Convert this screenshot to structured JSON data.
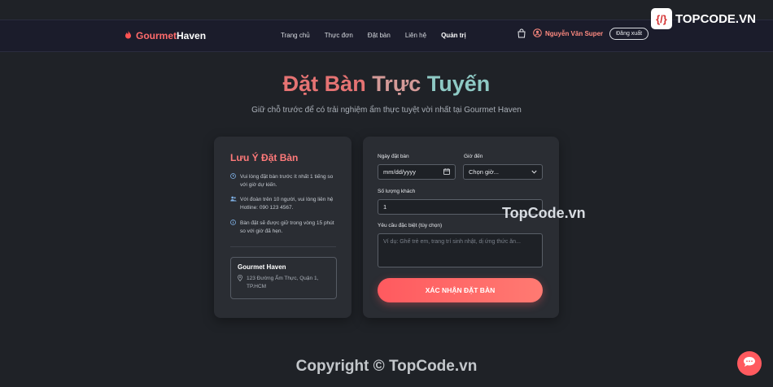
{
  "nav": {
    "brand_part1": "Gourmet",
    "brand_part2": "Haven",
    "links": [
      "Trang chủ",
      "Thực đơn",
      "Đặt bàn",
      "Liên hệ",
      "Quản trị"
    ],
    "user_name": "Nguyễn Văn Super",
    "logout_label": "Đăng xuất"
  },
  "watermark": {
    "logo_text": "TOPCODE.VN",
    "logo_glyph": "{/}",
    "mid_text": "TopCode.vn",
    "footer_text": "Copyright © TopCode.vn"
  },
  "hero": {
    "title_part1": "Đặt Bàn",
    "title_part2": "Trực",
    "title_part3": "Tuyến",
    "subtitle": "Giữ chỗ trước để có trải nghiệm ẩm thực tuyệt vời nhất tại Gourmet Haven"
  },
  "notes": {
    "title": "Lưu Ý Đặt Bàn",
    "items": [
      "Vui lòng đặt bàn trước ít nhất 1 tiếng so với giờ dự kiến.",
      "Với đoàn trên 10 người, vui lòng liên hệ Hotline: 090 123 4567.",
      "Bàn đặt sẽ được giữ trong vòng 15 phút so với giờ đã hẹn."
    ],
    "address": {
      "name": "Gourmet Haven",
      "line": "123 Đường Ẩm Thực, Quận 1, TP.HCM"
    }
  },
  "form": {
    "date_label": "Ngày đặt bàn",
    "date_value": "mm/dd/yyyy",
    "time_label": "Giờ đến",
    "time_value": "Chọn giờ...",
    "guests_label": "Số lượng khách",
    "guests_value": "1",
    "request_label": "Yêu cầu đặc biệt (tùy chọn)",
    "request_placeholder": "Ví dụ: Ghế trẻ em, trang trí sinh nhật, dị ứng thức ăn...",
    "submit_label": "XÁC NHẬN ĐẶT BÀN"
  },
  "colors": {
    "accent": "#ff5a5f",
    "background": "#1f2227",
    "panel": "#2a2d33",
    "navbar": "#1b1c2b"
  }
}
